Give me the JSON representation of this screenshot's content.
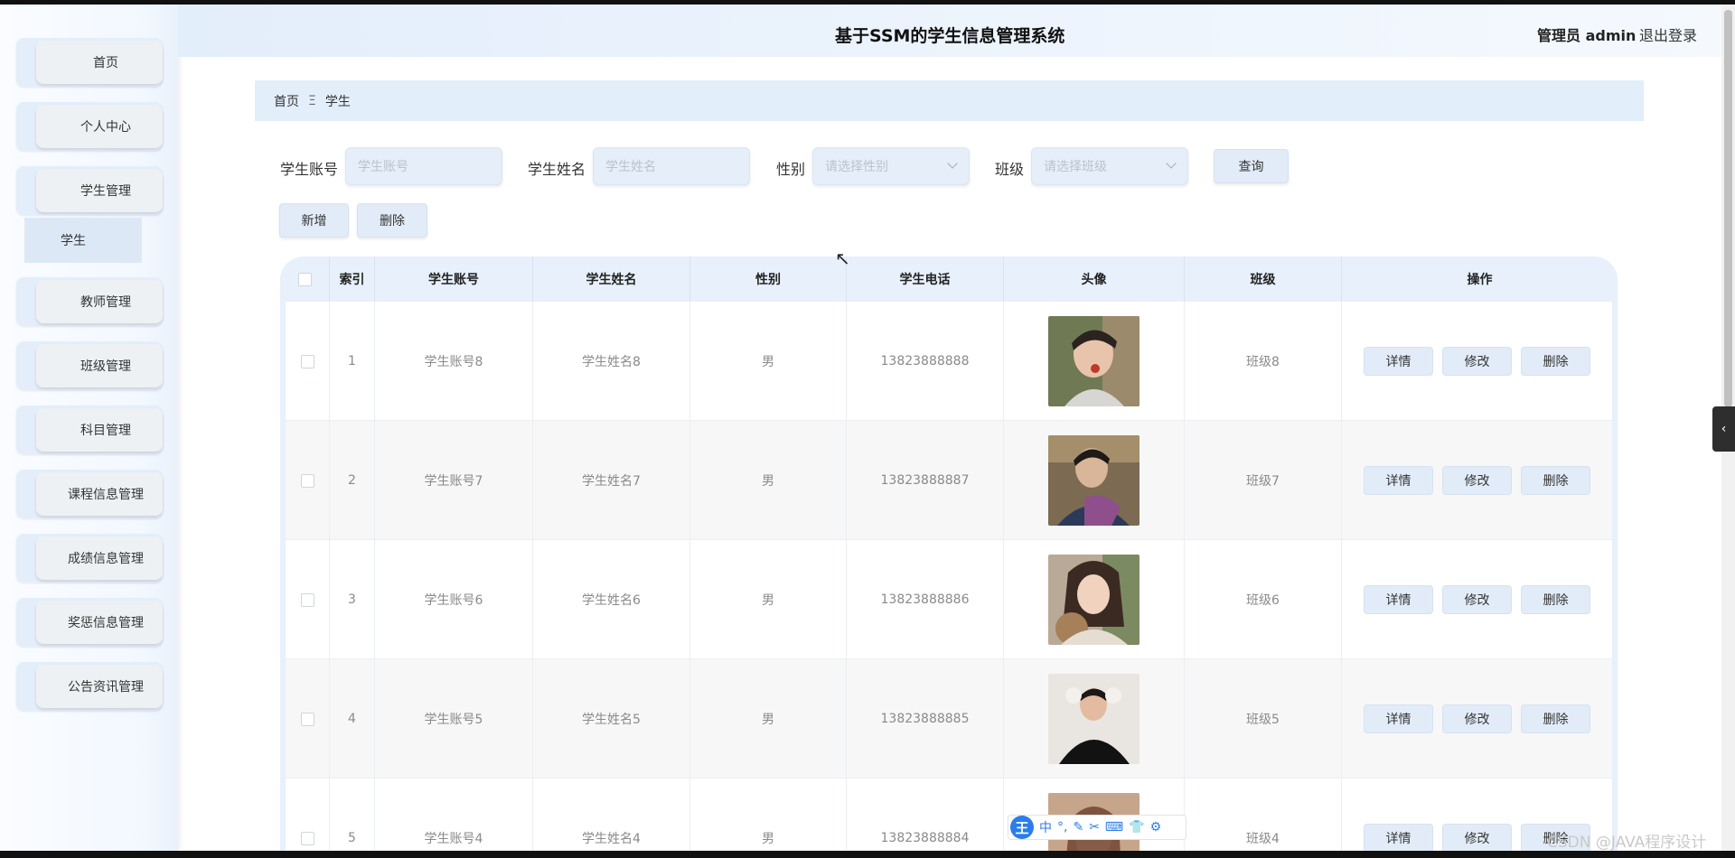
{
  "header": {
    "title": "基于SSM的学生信息管理系统",
    "user": "管理员 admin",
    "logout": "退出登录"
  },
  "sidebar": {
    "items": [
      {
        "label": "首页"
      },
      {
        "label": "个人中心"
      },
      {
        "label": "学生管理"
      },
      {
        "label": "教师管理"
      },
      {
        "label": "班级管理"
      },
      {
        "label": "科目管理"
      },
      {
        "label": "课程信息管理"
      },
      {
        "label": "成绩信息管理"
      },
      {
        "label": "奖惩信息管理"
      },
      {
        "label": "公告资讯管理"
      }
    ],
    "submenu": "学生"
  },
  "breadcrumb": {
    "home": "首页",
    "sep": "Ξ",
    "current": "学生"
  },
  "search": {
    "account_label": "学生账号",
    "account_placeholder": "学生账号",
    "name_label": "学生姓名",
    "name_placeholder": "学生姓名",
    "gender_label": "性别",
    "gender_placeholder": "请选择性别",
    "class_label": "班级",
    "class_placeholder": "请选择班级",
    "query_button": "查询"
  },
  "actions": {
    "add": "新增",
    "delete": "删除"
  },
  "table": {
    "headers": [
      "索引",
      "学生账号",
      "学生姓名",
      "性别",
      "学生电话",
      "头像",
      "班级",
      "操作"
    ],
    "rows": [
      {
        "index": "1",
        "account": "学生账号8",
        "name": "学生姓名8",
        "gender": "男",
        "phone": "13823888888",
        "class": "班级8"
      },
      {
        "index": "2",
        "account": "学生账号7",
        "name": "学生姓名7",
        "gender": "男",
        "phone": "13823888887",
        "class": "班级7"
      },
      {
        "index": "3",
        "account": "学生账号6",
        "name": "学生姓名6",
        "gender": "男",
        "phone": "13823888886",
        "class": "班级6"
      },
      {
        "index": "4",
        "account": "学生账号5",
        "name": "学生姓名5",
        "gender": "男",
        "phone": "13823888885",
        "class": "班级5"
      },
      {
        "index": "5",
        "account": "学生账号4",
        "name": "学生姓名4",
        "gender": "男",
        "phone": "13823888884",
        "class": "班级4"
      }
    ],
    "op_detail": "详情",
    "op_edit": "修改",
    "op_delete": "删除"
  },
  "ime": {
    "logo": "王",
    "items": [
      "中",
      "°,",
      "✎",
      "✂",
      "⌨",
      "👕",
      "⚙"
    ]
  },
  "watermark": "CSDN @JAVA程序设计",
  "colors": {
    "accent": "#e3eefb",
    "button": "#e2ecf8",
    "ime_blue": "#2b7de9"
  }
}
